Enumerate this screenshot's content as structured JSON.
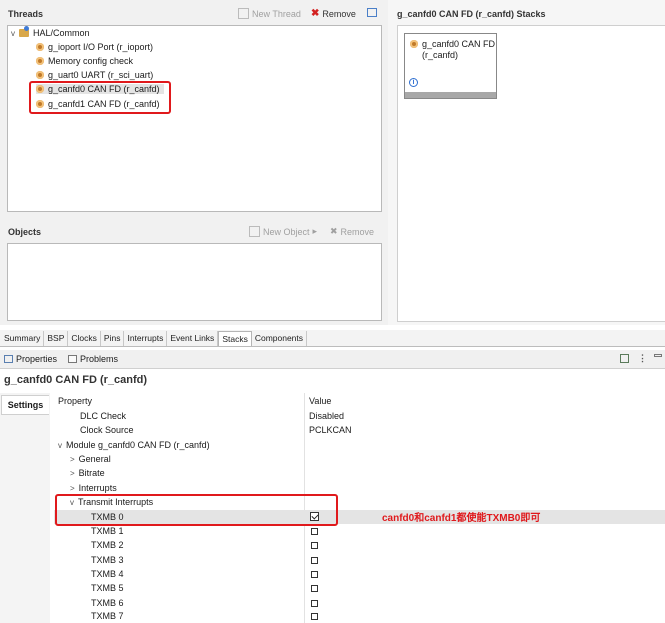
{
  "threads": {
    "title": "Threads",
    "new_thread": "New Thread",
    "remove": "Remove",
    "root": "HAL/Common",
    "items": [
      "g_ioport I/O Port (r_ioport)",
      "Memory config check",
      "g_uart0 UART (r_sci_uart)",
      "g_canfd0 CAN FD (r_canfd)",
      "g_canfd1 CAN FD (r_canfd)"
    ]
  },
  "objects": {
    "title": "Objects",
    "new_object": "New Object",
    "remove": "Remove"
  },
  "stacks": {
    "title": "g_canfd0 CAN FD (r_canfd) Stacks",
    "block_line1": "g_canfd0 CAN FD",
    "block_line2": "(r_canfd)"
  },
  "tabs": [
    "Summary",
    "BSP",
    "Clocks",
    "Pins",
    "Interrupts",
    "Event Links",
    "Stacks",
    "Components"
  ],
  "views": {
    "properties": "Properties",
    "problems": "Problems"
  },
  "properties": {
    "title": "g_canfd0 CAN FD (r_canfd)",
    "settings_tab": "Settings",
    "col_property": "Property",
    "col_value": "Value",
    "rows": [
      {
        "label": "DLC Check",
        "value": "Disabled"
      },
      {
        "label": "Clock Source",
        "value": "PCLKCAN"
      },
      {
        "label": "Module g_canfd0 CAN FD (r_canfd)",
        "value": ""
      },
      {
        "label": "General",
        "value": ""
      },
      {
        "label": "Bitrate",
        "value": ""
      },
      {
        "label": "Interrupts",
        "value": ""
      },
      {
        "label": "Transmit Interrupts",
        "value": ""
      },
      {
        "label": "TXMB 0",
        "value": ""
      },
      {
        "label": "TXMB 1",
        "value": ""
      },
      {
        "label": "TXMB 2",
        "value": ""
      },
      {
        "label": "TXMB 3",
        "value": ""
      },
      {
        "label": "TXMB 4",
        "value": ""
      },
      {
        "label": "TXMB 5",
        "value": ""
      },
      {
        "label": "TXMB 6",
        "value": ""
      },
      {
        "label": "TXMB 7",
        "value": ""
      }
    ]
  },
  "annotation": "canfd0和canfd1都使能TXMB0即可",
  "colors": {
    "annotation_red": "#e0191c",
    "selection": "#e4e4e4"
  }
}
